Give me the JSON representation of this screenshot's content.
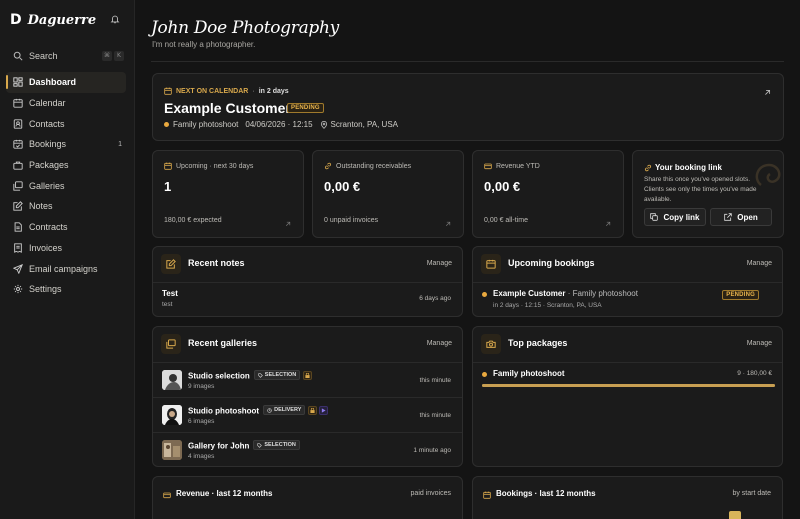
{
  "app": {
    "logo": "D",
    "name": "Daguerre"
  },
  "search": {
    "label": "Search",
    "kbd1": "⌘",
    "kbd2": "K"
  },
  "nav": [
    {
      "label": "Dashboard",
      "icon": "dashboard-icon",
      "active": true
    },
    {
      "label": "Calendar",
      "icon": "calendar-icon"
    },
    {
      "label": "Contacts",
      "icon": "contacts-icon"
    },
    {
      "label": "Bookings",
      "icon": "bookings-icon",
      "badge": "1"
    },
    {
      "label": "Packages",
      "icon": "packages-icon"
    },
    {
      "label": "Galleries",
      "icon": "galleries-icon"
    },
    {
      "label": "Notes",
      "icon": "notes-icon"
    },
    {
      "label": "Contracts",
      "icon": "contracts-icon"
    },
    {
      "label": "Invoices",
      "icon": "invoices-icon"
    },
    {
      "label": "Email campaigns",
      "icon": "send-icon"
    },
    {
      "label": "Settings",
      "icon": "settings-icon"
    }
  ],
  "page": {
    "title": "John Doe Photography",
    "subtitle": "I'm not really a photographer."
  },
  "next": {
    "eyebrow": "NEXT ON CALENDAR",
    "sep": "·",
    "when": "in 2 days",
    "customer": "Example Customer",
    "status": "PENDING",
    "service": "Family photoshoot",
    "datetime": "04/06/2026 · 12:15",
    "location": "Scranton, PA, USA"
  },
  "stats": [
    {
      "label": "Upcoming · next 30 days",
      "value": "1",
      "foot": "180,00 € expected"
    },
    {
      "label": "Outstanding receivables",
      "value": "0,00 €",
      "foot": "0 unpaid invoices"
    },
    {
      "label": "Revenue YTD",
      "value": "0,00 €",
      "foot": "0,00 € all-time"
    }
  ],
  "booking_link": {
    "title": "Your booking link",
    "desc": "Share this once you've opened slots. Clients see only the times you've made available.",
    "copy": "Copy link",
    "open": "Open"
  },
  "recent_notes": {
    "title": "Recent notes",
    "action": "Manage",
    "items": [
      {
        "title": "Test",
        "sub": "test",
        "time": "6 days ago"
      }
    ]
  },
  "upcoming_bookings": {
    "title": "Upcoming bookings",
    "action": "Manage",
    "items": [
      {
        "customer": "Example Customer",
        "service": " · Family photoshoot",
        "status": "PENDING",
        "sub": "in 2 days · 12:15 · Scranton, PA, USA"
      }
    ]
  },
  "recent_galleries": {
    "title": "Recent galleries",
    "action": "Manage",
    "items": [
      {
        "title": "Studio selection",
        "tag": "SELECTION",
        "sub": "9 images",
        "time": "this minute"
      },
      {
        "title": "Studio photoshoot",
        "tag": "DELIVERY",
        "sub": "6 images",
        "time": "this minute"
      },
      {
        "title": "Gallery for John",
        "tag": "SELECTION",
        "sub": "4 images",
        "time": "1 minute ago"
      }
    ]
  },
  "top_packages": {
    "title": "Top packages",
    "action": "Manage",
    "items": [
      {
        "name": "Family photoshoot",
        "stats": "9 · 180,00 €",
        "share": 1.0
      }
    ]
  },
  "revenue": {
    "title": "Revenue · last 12 months",
    "note": "paid invoices"
  },
  "bookings_chart": {
    "title": "Bookings · last 12 months",
    "note": "by start date"
  },
  "colors": {
    "accent": "#d8a84c",
    "background": "#141414",
    "card": "#1b1b1b"
  }
}
